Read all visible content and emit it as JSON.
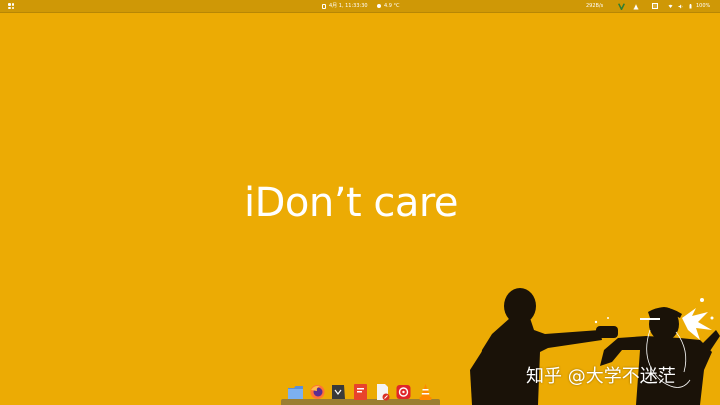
{
  "top_panel": {
    "clock": "4月 1, 11:33:30",
    "weather": "4.9 °C",
    "net_speed": "292B/s",
    "battery": "100%"
  },
  "desktop": {
    "wallpaper_text": "iDon’t care",
    "watermark": "知乎 @大学不迷茫"
  },
  "dock": {
    "items": [
      {
        "icon": "files-icon"
      },
      {
        "icon": "firefox-icon"
      },
      {
        "icon": "typora-icon"
      },
      {
        "icon": "wps-presentation-icon"
      },
      {
        "icon": "text-editor-icon"
      },
      {
        "icon": "netease-music-icon"
      },
      {
        "icon": "vlc-icon"
      }
    ]
  },
  "colors": {
    "wallpaper": "#ecab04",
    "panel": "#cf9806",
    "text": "#ffffff",
    "silhouette": "#1a1208"
  }
}
